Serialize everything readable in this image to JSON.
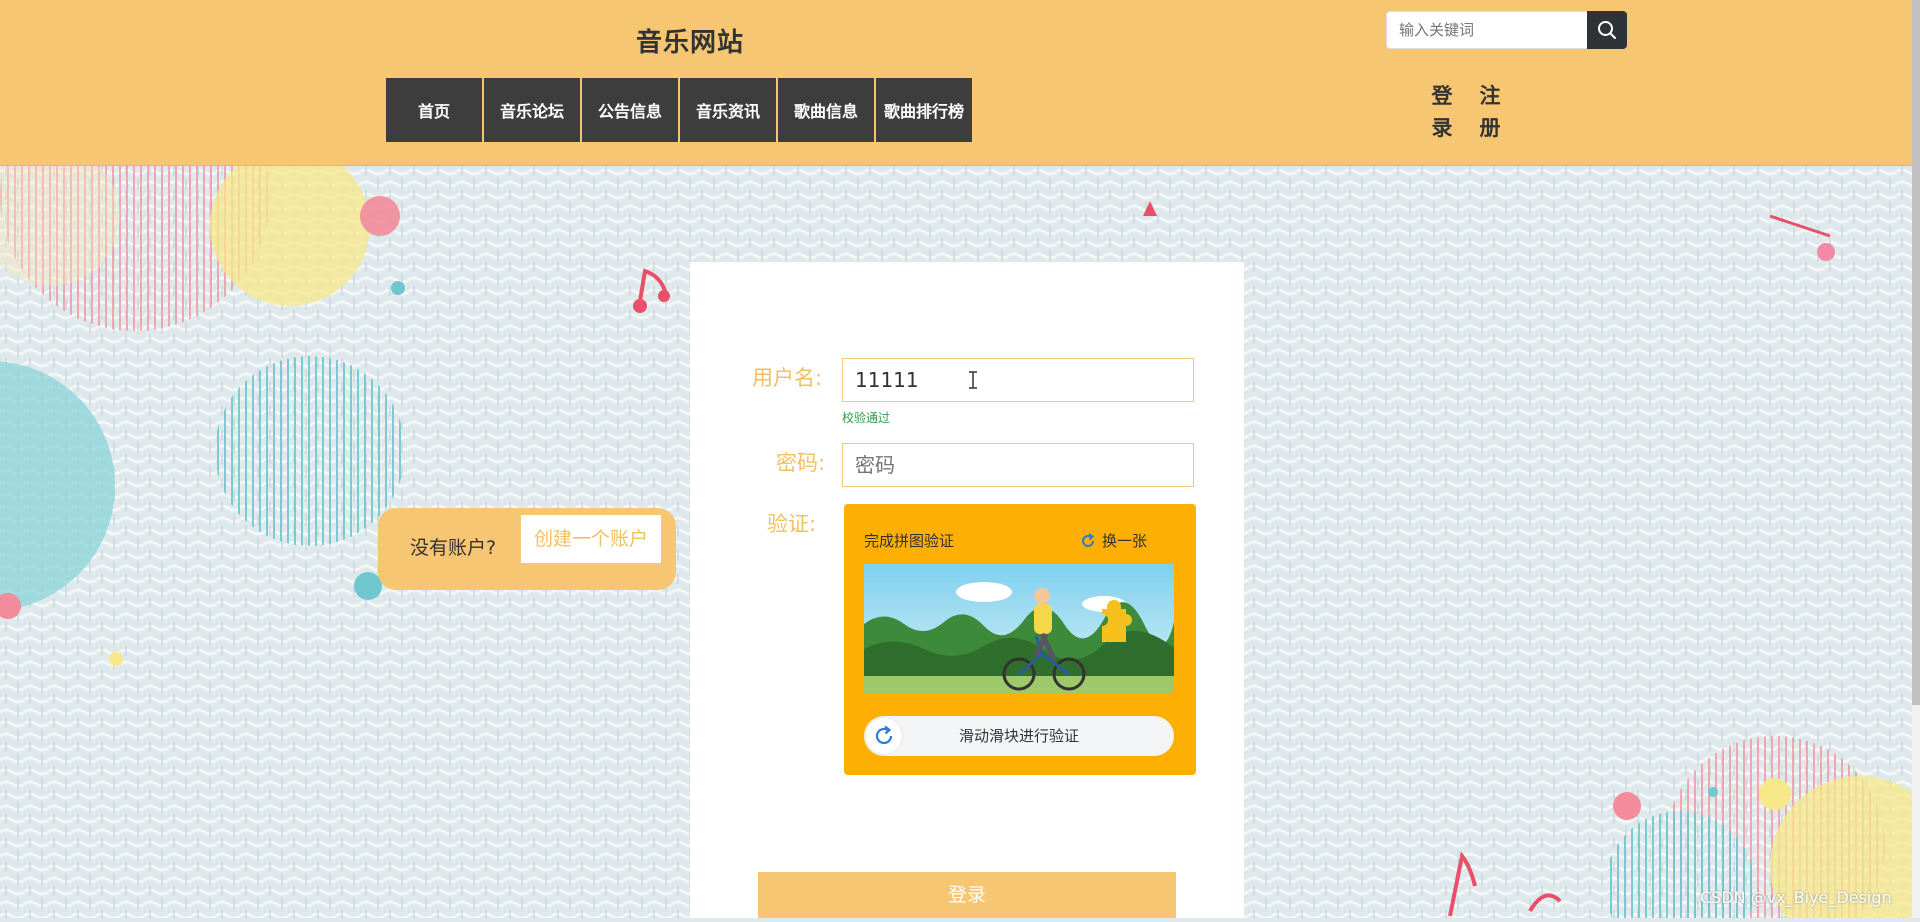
{
  "header": {
    "site_title": "音乐网站",
    "nav": [
      "首页",
      "音乐论坛",
      "公告信息",
      "音乐资讯",
      "歌曲信息",
      "歌曲排行榜"
    ],
    "search_placeholder": "输入关键词",
    "login": [
      "登",
      "录"
    ],
    "register": [
      "注",
      "册"
    ]
  },
  "form": {
    "username_label": "用户名:",
    "username_value": "11111",
    "username_hint": "校验通过",
    "password_label": "密码:",
    "password_placeholder": "密码",
    "captcha_label": "验证:",
    "captcha_title": "完成拼图验证",
    "captcha_refresh": "换一张",
    "captcha_slider": "滑动滑块进行验证",
    "login_button": "登录"
  },
  "signup_prompt": {
    "text": "没有账户?",
    "button": "创建一个账户"
  },
  "watermark": "CSDN @vx_Biye_Design",
  "colors": {
    "header": "#f7c672",
    "nav": "#3d3d3d",
    "captcha": "#fdb003",
    "accent_text": "#f2c05f",
    "hint_green": "#2e9a4a"
  }
}
